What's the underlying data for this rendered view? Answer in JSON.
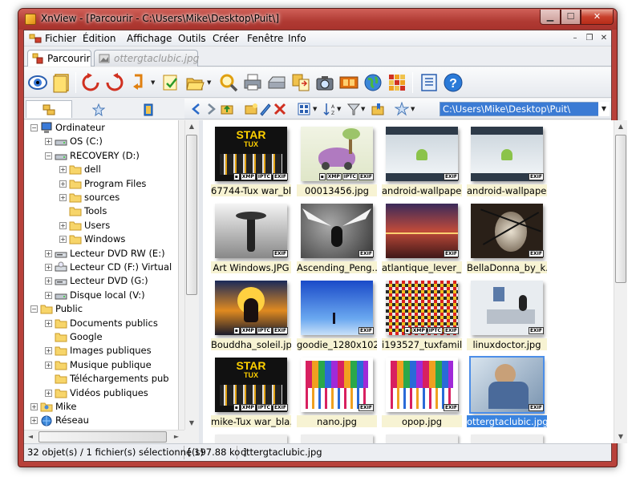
{
  "window": {
    "title": "XnView - [Parcourir - C:\\Users\\Mike\\Desktop\\Puit\\]",
    "min_glyph": "▁",
    "max_glyph": "☐",
    "close_glyph": "✕"
  },
  "menu": {
    "items": [
      "Fichier",
      "Édition",
      "Affichage",
      "Outils",
      "Créer",
      "Fenêtre",
      "Info"
    ],
    "mdi_min": "–",
    "mdi_restore": "❐",
    "mdi_close": "✕"
  },
  "tabs": [
    {
      "label": "Parcourir",
      "active": true
    },
    {
      "label": "ottergtaclubic.jpg",
      "active": false
    }
  ],
  "toolbar": {
    "icons": [
      "eye-icon",
      "page-icon",
      "rotate-left-icon",
      "rotate-right-icon",
      "refresh-icon",
      "select-icon",
      "open-folder-icon",
      "search-icon",
      "print-icon",
      "scanner-icon",
      "convert-icon",
      "camera-icon",
      "filmstrip-icon",
      "globe-icon",
      "grid-icon",
      "settings-icon",
      "help-icon"
    ]
  },
  "navbar": {
    "path": "C:\\Users\\Mike\\Desktop\\Puit\\"
  },
  "tree": {
    "items": [
      {
        "label": "Ordinateur",
        "level": 0,
        "icon": "computer-icon",
        "expander": "−"
      },
      {
        "label": "OS (C:)",
        "level": 1,
        "icon": "drive-icon",
        "expander": "+"
      },
      {
        "label": "RECOVERY (D:)",
        "level": 1,
        "icon": "drive-icon",
        "expander": "−"
      },
      {
        "label": "dell",
        "level": 2,
        "icon": "folder-icon",
        "expander": "+"
      },
      {
        "label": "Program Files",
        "level": 2,
        "icon": "folder-icon",
        "expander": "+"
      },
      {
        "label": "sources",
        "level": 2,
        "icon": "folder-icon",
        "expander": "+"
      },
      {
        "label": "Tools",
        "level": 2,
        "icon": "folder-icon",
        "expander": ""
      },
      {
        "label": "Users",
        "level": 2,
        "icon": "folder-icon",
        "expander": "+"
      },
      {
        "label": "Windows",
        "level": 2,
        "icon": "folder-icon",
        "expander": "+"
      },
      {
        "label": "Lecteur DVD RW (E:)",
        "level": 1,
        "icon": "dvd-icon",
        "expander": "+"
      },
      {
        "label": "Lecteur CD (F:) Virtual",
        "level": 1,
        "icon": "cd-icon",
        "expander": "+"
      },
      {
        "label": "Lecteur DVD (G:)",
        "level": 1,
        "icon": "dvd-icon",
        "expander": "+"
      },
      {
        "label": "Disque local (V:)",
        "level": 1,
        "icon": "drive-icon",
        "expander": "+"
      },
      {
        "label": "Public",
        "level": 0,
        "icon": "folder-icon",
        "expander": "−"
      },
      {
        "label": "Documents publics",
        "level": 1,
        "icon": "folder-icon",
        "expander": "+"
      },
      {
        "label": "Google",
        "level": 1,
        "icon": "folder-icon",
        "expander": ""
      },
      {
        "label": "Images publiques",
        "level": 1,
        "icon": "folder-icon",
        "expander": "+"
      },
      {
        "label": "Musique publique",
        "level": 1,
        "icon": "folder-icon",
        "expander": "+"
      },
      {
        "label": "Téléchargements pub",
        "level": 1,
        "icon": "folder-icon",
        "expander": ""
      },
      {
        "label": "Vidéos publiques",
        "level": 1,
        "icon": "folder-icon",
        "expander": "+"
      },
      {
        "label": "Mike",
        "level": 0,
        "icon": "user-folder-icon",
        "expander": "+"
      },
      {
        "label": "Réseau",
        "level": 0,
        "icon": "network-icon",
        "expander": "+"
      }
    ]
  },
  "thumbnails": [
    {
      "name": "67744-Tux war_bl...",
      "badges": [
        "▪",
        "XMP",
        "IPTC",
        "EXIF"
      ],
      "art": "tux"
    },
    {
      "name": "00013456.jpg",
      "badges": [
        "▪",
        "XMP",
        "IPTC",
        "EXIF"
      ],
      "art": "drawing"
    },
    {
      "name": "android-wallpape...",
      "badges": [
        "EXIF"
      ],
      "art": "android"
    },
    {
      "name": "android-wallpape...",
      "badges": [
        "EXIF"
      ],
      "art": "android"
    },
    {
      "name": "Art Windows.JPG",
      "badges": [
        "EXIF"
      ],
      "art": "bw"
    },
    {
      "name": "Ascending_Peng...",
      "badges": [
        "EXIF"
      ],
      "art": "penguin"
    },
    {
      "name": "atlantique_lever_...",
      "badges": [
        "EXIF"
      ],
      "art": "sunset"
    },
    {
      "name": "BellaDonna_by_k...",
      "badges": [
        "EXIF"
      ],
      "art": "bella"
    },
    {
      "name": "Bouddha_soleil.jpg",
      "badges": [
        "▪",
        "XMP",
        "IPTC",
        "EXIF"
      ],
      "art": "buddha"
    },
    {
      "name": "goodie_1280x102...",
      "badges": [
        "EXIF"
      ],
      "art": "blue"
    },
    {
      "name": "i193527_tuxfamily...",
      "badges": [
        "▪",
        "XMP",
        "IPTC",
        "EXIF"
      ],
      "art": "mosaic"
    },
    {
      "name": "linuxdoctor.jpg",
      "badges": [
        "EXIF"
      ],
      "art": "doctor"
    },
    {
      "name": "mike-Tux war_bla...",
      "badges": [
        "▪",
        "XMP",
        "IPTC",
        "EXIF"
      ],
      "art": "tux"
    },
    {
      "name": "nano.jpg",
      "badges": [
        "EXIF"
      ],
      "art": "nano"
    },
    {
      "name": "opop.jpg",
      "badges": [
        "EXIF"
      ],
      "art": "nano"
    },
    {
      "name": "ottergtaclubic.jpg",
      "badges": [
        "EXIF"
      ],
      "art": "otter",
      "selected": true
    }
  ],
  "status": {
    "count": "32 objet(s) / 1 fichier(s) sélectionné(s)",
    "size": "[ 197.88 ko ]",
    "filename": "ottergtaclubic.jpg"
  },
  "art_text": {
    "star": "STAR",
    "tux": "TUX"
  },
  "scroll": {
    "up": "▲",
    "down": "▼",
    "left": "◄",
    "right": "►",
    "dd": "▼"
  }
}
